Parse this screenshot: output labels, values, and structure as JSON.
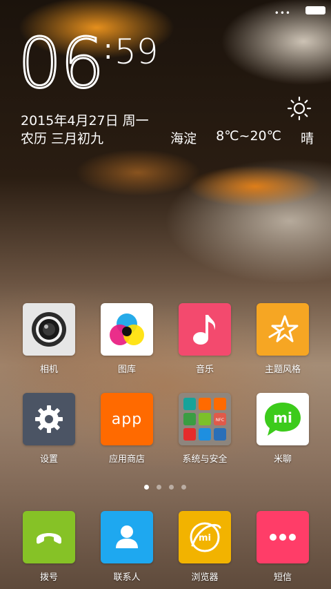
{
  "status_bar": {
    "signal_dots": "•••"
  },
  "clock": {
    "hour": "06",
    "minute": "59",
    "colon": ":"
  },
  "date": {
    "gregorian": "2015年4月27日 周一",
    "lunar": "农历 三月初九"
  },
  "weather": {
    "location": "海淀",
    "temperature": "8℃~20℃",
    "condition": "晴",
    "icon": "sun-icon"
  },
  "apps_row1": [
    {
      "label": "相机",
      "icon": "camera-icon",
      "color": "#e8e8e8"
    },
    {
      "label": "图库",
      "icon": "gallery-icon",
      "color": "#ffffff"
    },
    {
      "label": "音乐",
      "icon": "music-note-icon",
      "color": "#f34a6e"
    },
    {
      "label": "主题风格",
      "icon": "theme-star-icon",
      "color": "#f6a623"
    }
  ],
  "apps_row2": [
    {
      "label": "设置",
      "icon": "gear-icon",
      "color": "#4b5464"
    },
    {
      "label": "应用商店",
      "icon": "app-store-icon",
      "text": "app",
      "color": "#ff6a00"
    },
    {
      "label": "系统与安全",
      "icon": "folder-icon",
      "color": "#8e8a84"
    },
    {
      "label": "米聊",
      "icon": "miliao-icon",
      "text": "mi",
      "color": "#ffffff"
    }
  ],
  "pager": {
    "pages": 4,
    "current": 1
  },
  "dock": [
    {
      "label": "拨号",
      "icon": "phone-icon",
      "color": "#86c226"
    },
    {
      "label": "联系人",
      "icon": "contacts-icon",
      "color": "#1ea8f0"
    },
    {
      "label": "浏览器",
      "icon": "browser-icon",
      "text": "mi",
      "color": "#f2b300"
    },
    {
      "label": "短信",
      "icon": "messaging-icon",
      "color": "#ff3d68"
    }
  ],
  "folder_mini_labels": {
    "nfc": "NFC"
  }
}
